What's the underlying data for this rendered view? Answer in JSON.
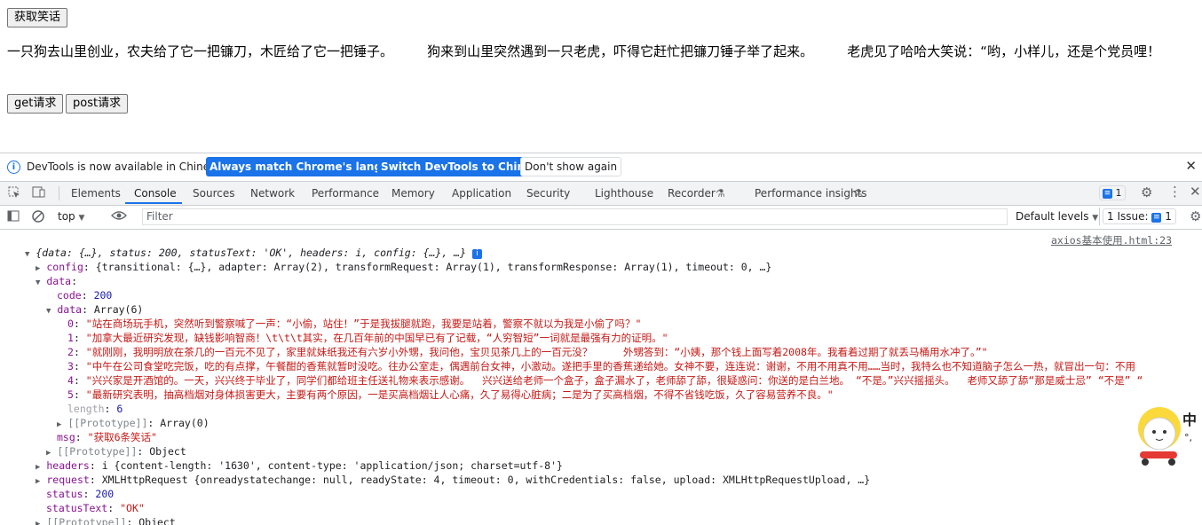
{
  "page": {
    "get_joke_button": "获取笑话",
    "joke_text": "一只狗去山里创业，农夫给了它一把镰刀，木匠给了它一把锤子。        狗来到山里突然遇到一只老虎，吓得它赶忙把镰刀锤子举了起来。        老虎见了哈哈大笑说：“哟，小样儿，还是个党员哩！",
    "get_button": "get请求",
    "post_button": "post请求"
  },
  "infobar": {
    "message": "DevTools is now available in Chinese!",
    "btn_match": "Always match Chrome's language",
    "btn_switch": "Switch DevTools to Chinese",
    "btn_dont": "Don't show again",
    "close": "✕"
  },
  "tabs": [
    "Elements",
    "Console",
    "Sources",
    "Network",
    "Performance",
    "Memory",
    "Application",
    "Security",
    "Lighthouse",
    "Recorder",
    "Performance insights"
  ],
  "active_tab": "Console",
  "issues_badge_count": "1",
  "toolbar": {
    "context": "top",
    "filter_placeholder": "Filter",
    "levels": "Default levels",
    "issues_label": "1 Issue:",
    "issues_count": "1"
  },
  "console": {
    "source_link": "axios基本使用.html:23",
    "summary": "{data: {…}, status: 200, statusText: 'OK', headers: i, config: {…}, …}",
    "config_line": "{transitional: {…}, adapter: Array(2), transformRequest: Array(1), transformResponse: Array(1), timeout: 0, …}",
    "code_val": "200",
    "array_label": "Array(6)",
    "items": [
      "\"站在商场玩手机，突然听到警察喊了一声：“小偷，站住！”于是我拔腿就跑，我要是站着，警察不就以为我是小偷了吗？\"",
      "\"加拿大最近研究发现，缺钱影响智商！\\t\\t\\t其实，在几百年前的中国早已有了记载，“人穷智短”一词就是最强有力的证明。\"",
      "\"就刚刚，我明明放在茶几的一百元不见了，家里就妹纸我还有六岁小外甥，我问他，宝贝见茶几上的一百元没？     外甥答到：“小姨，那个钱上面写着2008年。我看着过期了就丢马桶用水冲了。”\"",
      "\"中午在公司食堂吃完饭，吃的有点撑，午餐酣的香蕉就暂时没吃。往办公室走，偶遇前台女神，小激动。遂把手里的香蕉递给她。女神不要，连连说：谢谢，不用不用真不用……当时，我特么也不知道脑子怎么一热，就冒出一句：不用",
      "\"兴兴家是开酒馆的。一天，兴兴终于毕业了，同学们都给班主任送礼物来表示感谢。  兴兴送给老师一个盒子，盒子漏水了，老师舔了舔，很疑惑问：你送的是白兰地。 “不是。”兴兴摇摇头。  老师又舔了舔“那是威士忌” “不是” “",
      "\"最新研究表明，抽高档烟对身体损害更大，主要有两个原因，一是买高档烟让人心痛，久了易得心脏病；二是为了买高档烟，不得不省钱吃饭，久了容易营养不良。\""
    ],
    "length_val": "6",
    "proto_array": "Array(0)",
    "msg_val": "\"获取6条笑话\"",
    "proto_object": "Object",
    "headers_line": "i {content-length: '1630', content-type: 'application/json; charset=utf-8'}",
    "request_line": "XMLHttpRequest {onreadystatechange: null, readyState: 4, timeout: 0, withCredentials: false, upload: XMLHttpRequestUpload, …}",
    "status_val": "200",
    "statusText_val": "\"OK\""
  }
}
